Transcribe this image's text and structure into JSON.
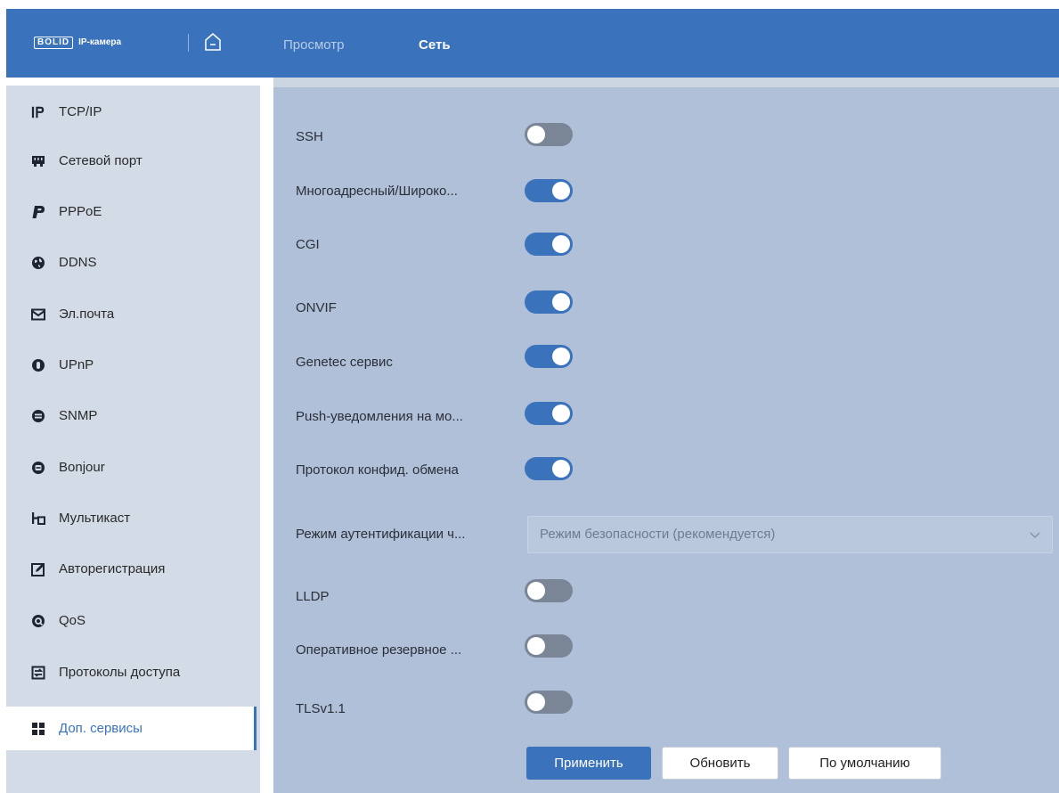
{
  "header": {
    "logo_box": "BOLID",
    "logo_text": "IP-камера",
    "tabs": [
      {
        "label": "Просмотр"
      },
      {
        "label": "Сеть"
      }
    ],
    "colors": {
      "bar": "#3a73bc",
      "active_tab": "#ffffff",
      "inactive_tab": "#b8cbe6"
    }
  },
  "sidebar": {
    "items": [
      {
        "label": "TCP/IP",
        "icon": "ip-icon"
      },
      {
        "label": "Сетевой порт",
        "icon": "network-port-icon"
      },
      {
        "label": "PPPoE",
        "icon": "pppoe-icon"
      },
      {
        "label": "DDNS",
        "icon": "globe-icon"
      },
      {
        "label": "Эл.почта",
        "icon": "mail-icon"
      },
      {
        "label": "UPnP",
        "icon": "upnp-icon"
      },
      {
        "label": "SNMP",
        "icon": "snmp-icon"
      },
      {
        "label": "Bonjour",
        "icon": "bonjour-icon"
      },
      {
        "label": "Мультикаст",
        "icon": "multicast-icon"
      },
      {
        "label": "Авторегистрация",
        "icon": "edit-icon"
      },
      {
        "label": "QoS",
        "icon": "qos-icon"
      },
      {
        "label": "Протоколы доступа",
        "icon": "access-protocols-icon"
      },
      {
        "label": "Доп. сервисы",
        "icon": "grid-icon",
        "selected": true
      }
    ]
  },
  "settings": {
    "rows": [
      {
        "label": "SSH",
        "enabled": false
      },
      {
        "label": "Многоадресный/Широко...",
        "enabled": true
      },
      {
        "label": "CGI",
        "enabled": true
      },
      {
        "label": "ONVIF",
        "enabled": true
      },
      {
        "label": "Genetec сервис",
        "enabled": true
      },
      {
        "label": "Push-уведомления на мо...",
        "enabled": true
      },
      {
        "label": "Протокол конфид. обмена",
        "enabled": true
      }
    ],
    "auth_mode": {
      "label": "Режим аутентификации ч...",
      "value": "Режим безопасности (рекомендуется)"
    },
    "rows2": [
      {
        "label": "LLDP",
        "enabled": false
      },
      {
        "label": "Оперативное резервное ...",
        "enabled": false
      },
      {
        "label": "TLSv1.1",
        "enabled": false
      }
    ]
  },
  "buttons": {
    "apply": "Применить",
    "refresh": "Обновить",
    "default": "По умолчанию"
  }
}
